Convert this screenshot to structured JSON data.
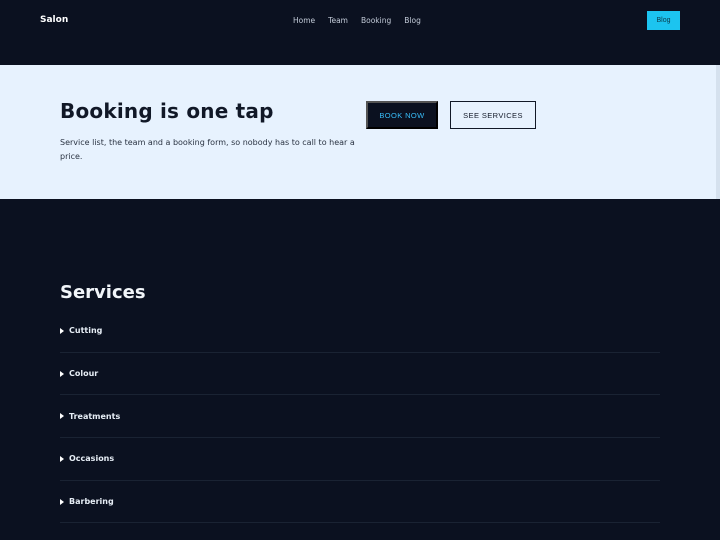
{
  "header": {
    "brand": "Salon",
    "nav": [
      "Home",
      "Team",
      "Booking",
      "Blog"
    ],
    "cta": "Blog"
  },
  "hero": {
    "title": "Booking is one tap",
    "subtitle": "Service list, the team and a booking form, so nobody has to call to hear a price.",
    "primary_button": "BOOK NOW",
    "secondary_button": "SEE SERVICES"
  },
  "services": {
    "title": "Services",
    "items": [
      "Cutting",
      "Colour",
      "Treatments",
      "Occasions",
      "Barbering"
    ]
  },
  "colors": {
    "background": "#0b1120",
    "hero_background": "#e7f2fe",
    "accent": "#1cc4f0"
  }
}
